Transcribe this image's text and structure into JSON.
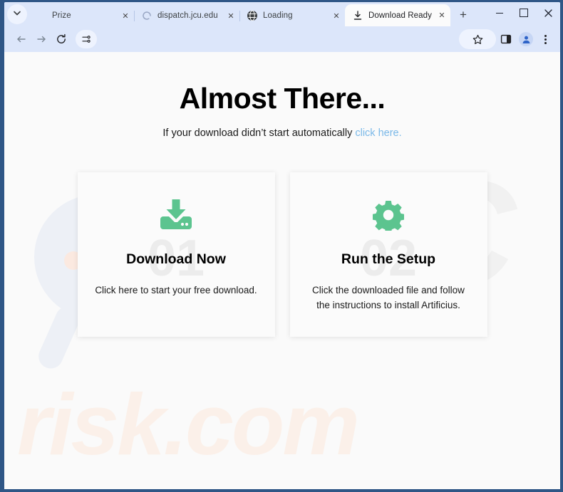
{
  "browser": {
    "tab_search_icon": "chevron-down-icon",
    "tabs": [
      {
        "title": "Prize",
        "favicon": "blank-icon",
        "close_label": "✕",
        "active": false
      },
      {
        "title": "dispatch.jcu.edu",
        "favicon": "loading-spinner-icon",
        "close_label": "✕",
        "active": false
      },
      {
        "title": "Loading",
        "favicon": "globe-icon",
        "close_label": "✕",
        "active": false
      },
      {
        "title": "Download Ready",
        "favicon": "download-icon",
        "close_label": "✕",
        "active": true
      }
    ],
    "new_tab_label": "+",
    "window_controls": {
      "minimize": "minimize-icon",
      "maximize": "maximize-icon",
      "close": "close-icon"
    },
    "toolbar": {
      "back": "back-arrow-icon",
      "forward": "forward-arrow-icon",
      "reload": "reload-icon",
      "tune": "tune-sliders-icon",
      "bookmark": "star-icon",
      "side_panel": "side-panel-icon",
      "profile": "profile-avatar-icon",
      "menu": "kebab-menu-icon"
    }
  },
  "page": {
    "headline": "Almost There...",
    "subline_text": "If your download didn’t start automatically ",
    "subline_link": "click here.",
    "link_color": "#7ab8e8",
    "accent_color": "#5cc48f",
    "watermark": {
      "logo_text": "PC",
      "domain_text": "risk.com",
      "glass_icon": "magnifying-glass-icon"
    },
    "cards": [
      {
        "number": "01",
        "icon": "download-tray-icon",
        "title": "Download Now",
        "description": "Click here to start your free download."
      },
      {
        "number": "02",
        "icon": "gear-icon",
        "title": "Run the Setup",
        "description": "Click the downloaded file and follow the instructions to install Artificius."
      }
    ]
  }
}
